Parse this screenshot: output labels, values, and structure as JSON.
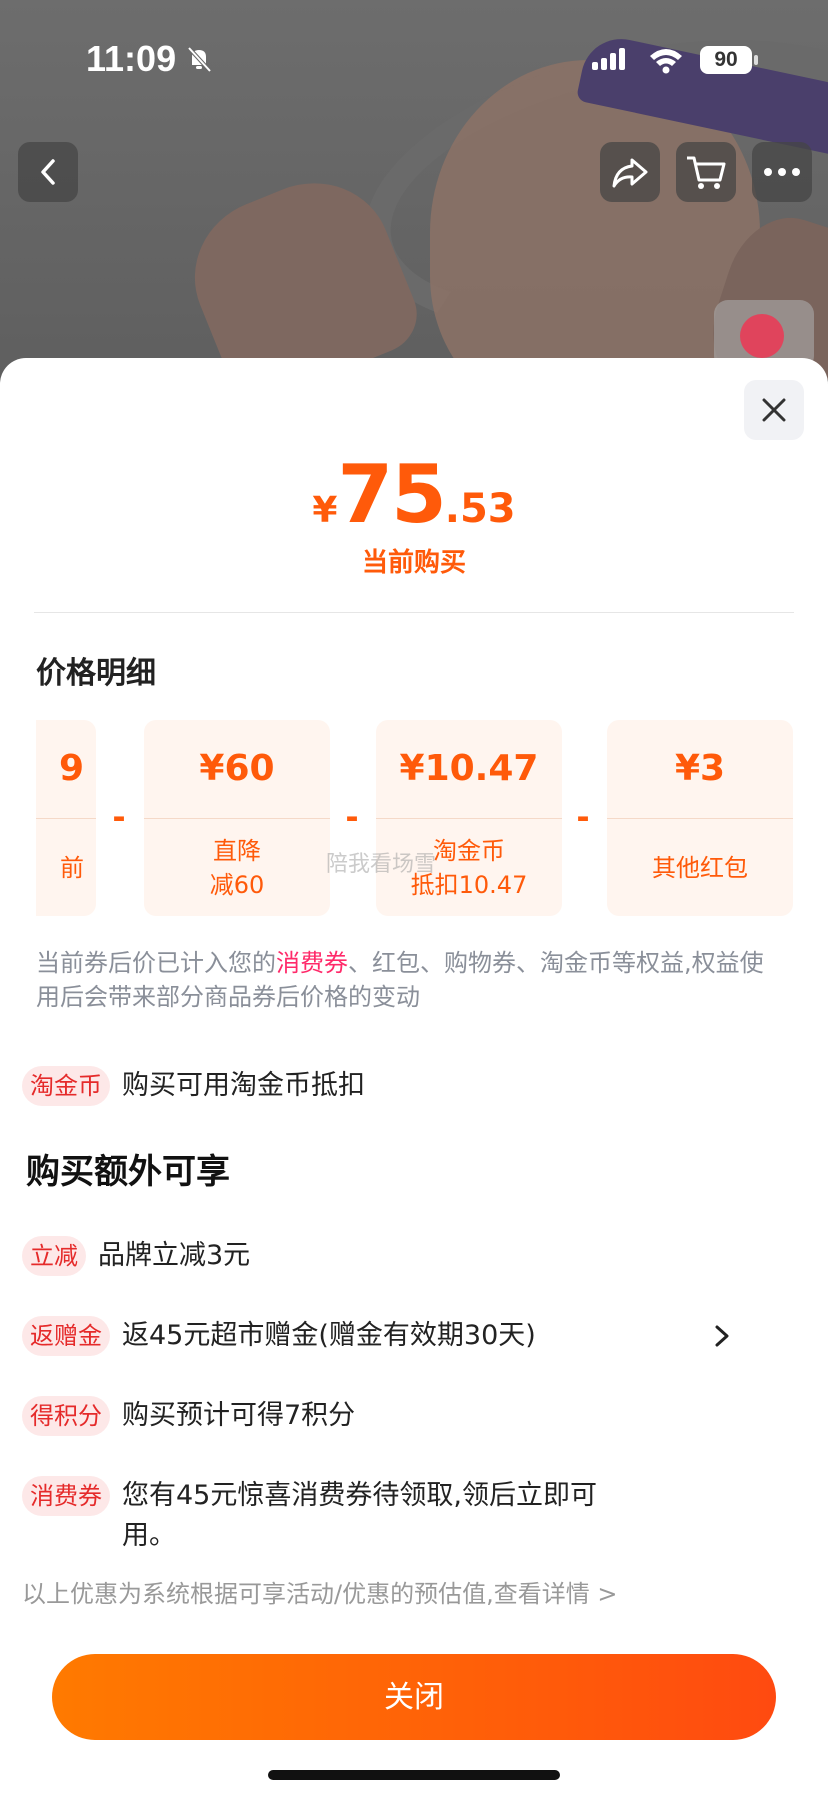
{
  "status_bar": {
    "time": "11:09",
    "battery": "90"
  },
  "price": {
    "currency": "¥",
    "integer": "75",
    "decimal": ".53",
    "label": "当前购买"
  },
  "breakdown": {
    "title": "价格明细",
    "cards": [
      {
        "amount": "9",
        "desc_lines": [
          "前",
          ""
        ]
      },
      {
        "amount": "¥60",
        "desc_lines": [
          "直降",
          "减60"
        ]
      },
      {
        "amount": "¥10.47",
        "desc_lines": [
          "淘金币",
          "抵扣10.47"
        ]
      },
      {
        "amount": "¥3",
        "desc_lines": [
          "其他红包",
          ""
        ]
      }
    ],
    "separator": "-",
    "watermark": "陪我看场雪"
  },
  "note": {
    "prefix": "当前券后价已计入您的",
    "highlight": "消费券",
    "suffix": "、红包、购物券、淘金币等权益,权益使用后会带来部分商品券后价格的变动"
  },
  "taojinbi_row": {
    "tag": "淘金币",
    "text": "购买可用淘金币抵扣"
  },
  "extras": {
    "title": "购买额外可享",
    "items": [
      {
        "tag": "立减",
        "text": "品牌立减3元"
      },
      {
        "tag": "返赠金",
        "text": "返45元超市赠金(赠金有效期30天)"
      },
      {
        "tag": "得积分",
        "text": "购买预计可得7积分"
      },
      {
        "tag": "消费券",
        "text_line1": "您有45元惊喜消费券待领取,领后立即可",
        "text_line2": "用。"
      }
    ]
  },
  "disclaimer": "以上优惠为系统根据可享活动/优惠的预估值,查看详情 >",
  "close_button": "关闭",
  "icons": [
    "back-icon",
    "share-icon",
    "cart-icon",
    "more-icon",
    "close-icon",
    "chevron-right-icon"
  ],
  "colors": {
    "accent": "#ff5a0a",
    "highlight": "#ff2a6a",
    "tag_bg": "#fde8e8",
    "tag_text": "#e52a2a"
  }
}
